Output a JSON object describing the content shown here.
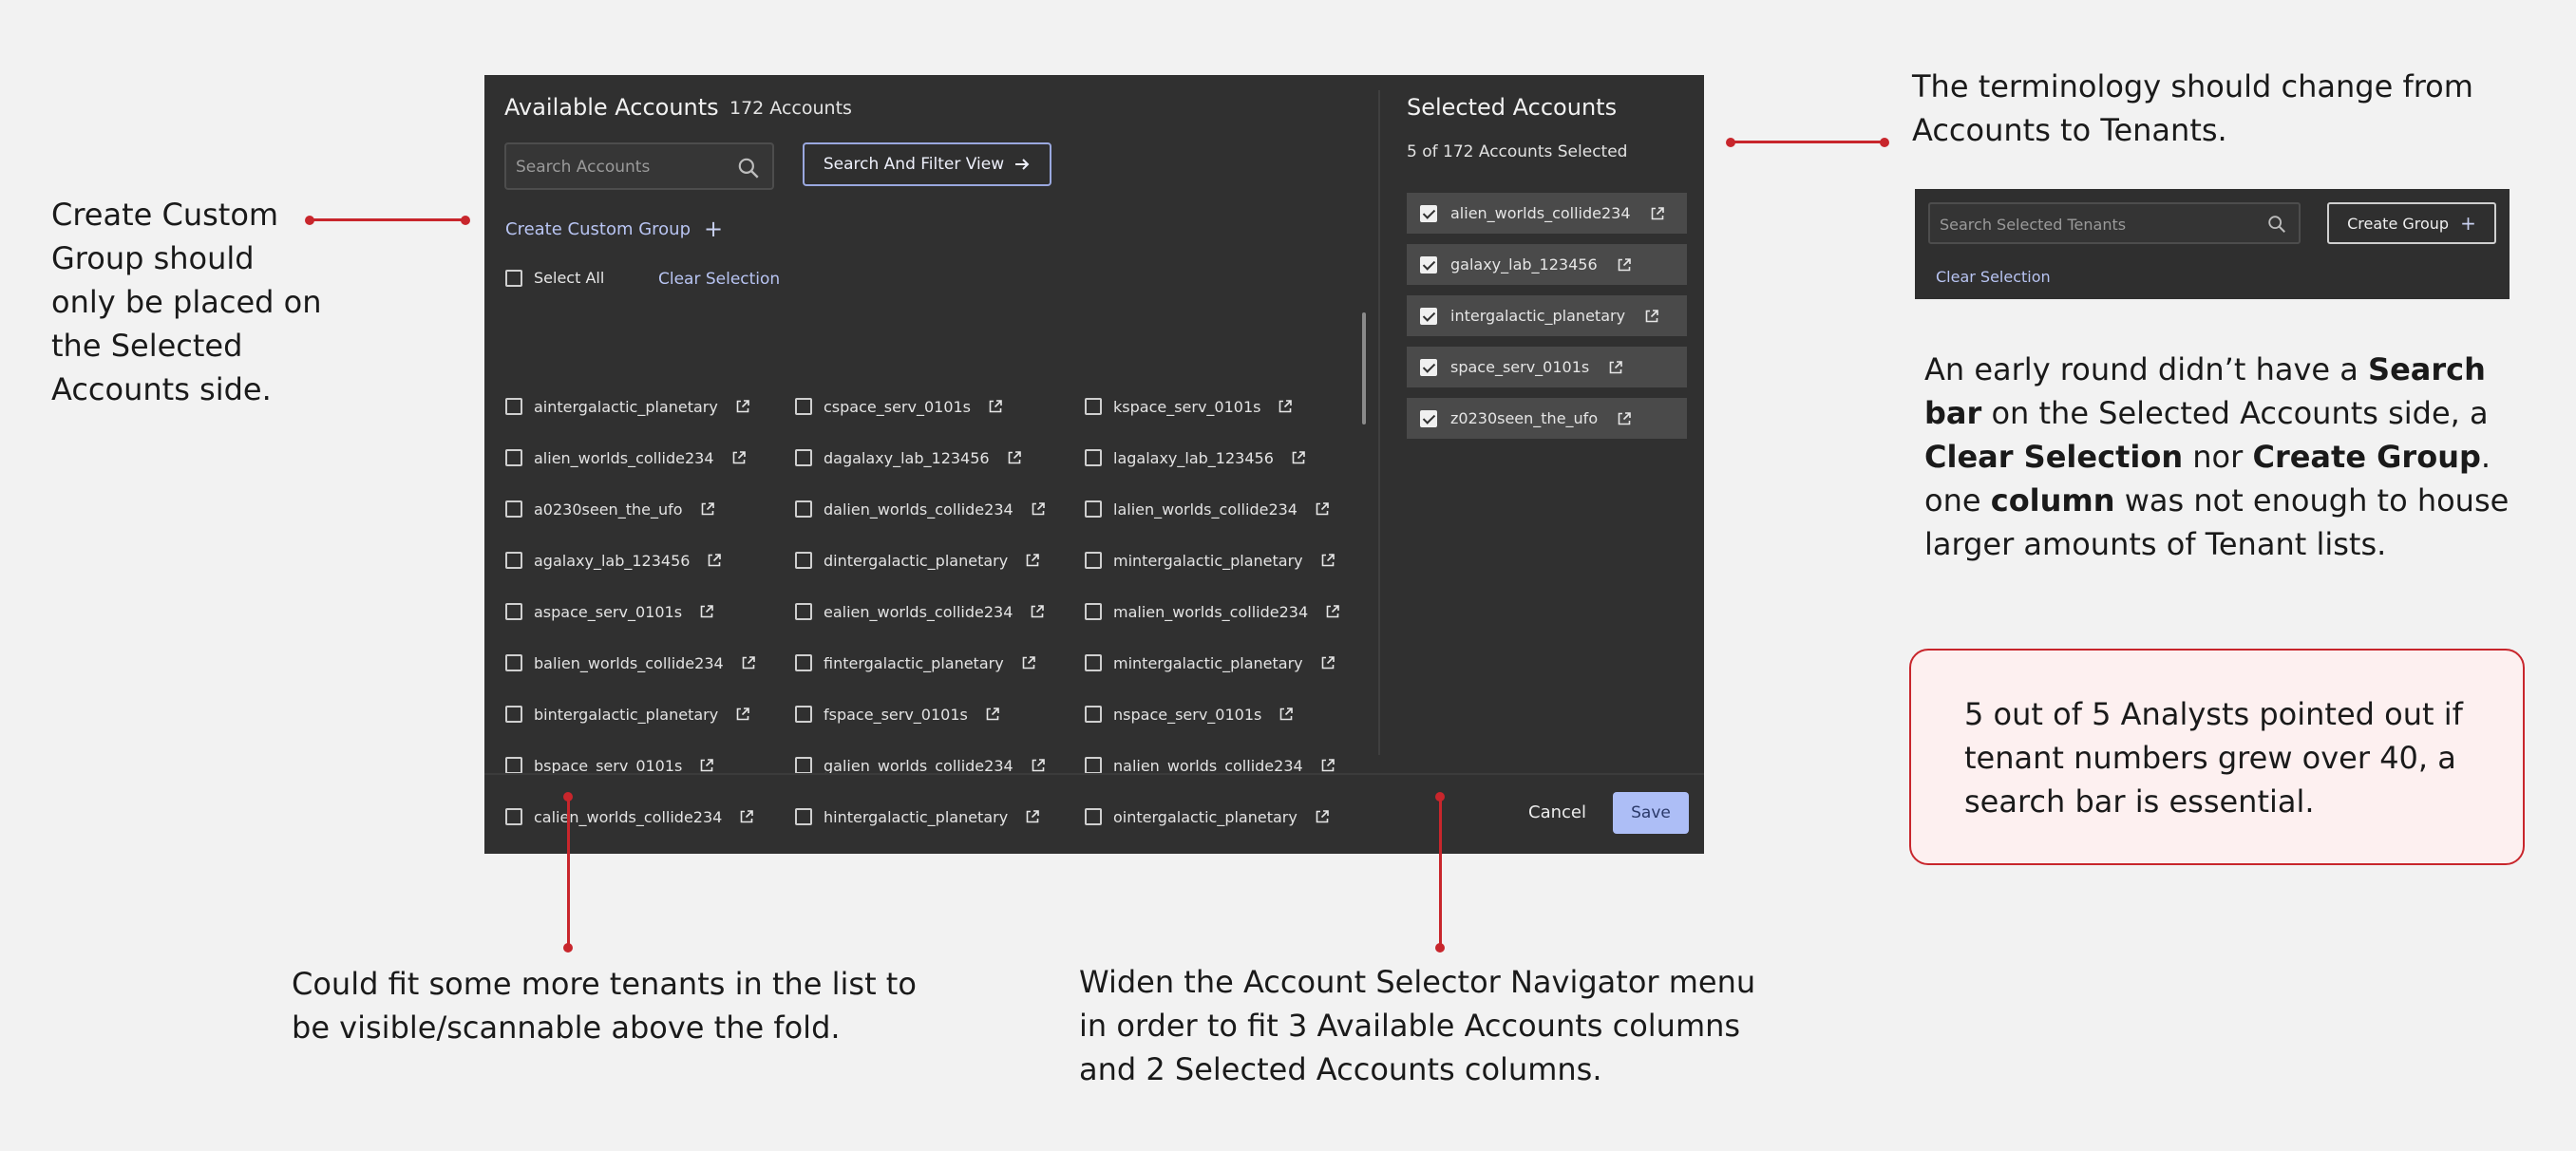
{
  "dialog": {
    "available": {
      "title": "Available Accounts",
      "count": "172 Accounts",
      "search_placeholder": "Search Accounts",
      "filter_button": "Search And Filter View",
      "custom_group": "Create Custom Group",
      "select_all": "Select All",
      "clear_selection": "Clear Selection",
      "columns": [
        [
          "aintergalactic_planetary",
          "alien_worlds_collide234",
          "a0230seen_the_ufo",
          "agalaxy_lab_123456",
          "aspace_serv_0101s",
          "balien_worlds_collide234",
          "bintergalactic_planetary",
          "bspace_serv_0101s",
          "calien_worlds_collide234"
        ],
        [
          "cspace_serv_0101s",
          "dagalaxy_lab_123456",
          "dalien_worlds_collide234",
          "dintergalactic_planetary",
          "ealien_worlds_collide234",
          "fintergalactic_planetary",
          "fspace_serv_0101s",
          "galien_worlds_collide234",
          "hintergalactic_planetary"
        ],
        [
          "kspace_serv_0101s",
          "lagalaxy_lab_123456",
          "lalien_worlds_collide234",
          "mintergalactic_planetary",
          "malien_worlds_collide234",
          "mintergalactic_planetary",
          "nspace_serv_0101s",
          "nalien_worlds_collide234",
          "ointergalactic_planetary"
        ]
      ]
    },
    "selected": {
      "title": "Selected Accounts",
      "count": "5 of 172 Accounts Selected",
      "items": [
        "alien_worlds_collide234",
        "galaxy_lab_123456",
        "intergalactic_planetary",
        "space_serv_0101s",
        "z0230seen_the_ufo"
      ]
    },
    "footer": {
      "cancel": "Cancel",
      "save": "Save"
    }
  },
  "notes": {
    "custom_group": "Create Custom Group should only be placed on the Selected Accounts side.",
    "terminology": "The terminology should change from Accounts to Tenants.",
    "scannable": "Could fit some more tenants in the list to be visible/scannable above the fold.",
    "widen": "Widen the Account Selector Navigator menu in order to fit 3 Available Accounts columns and 2 Selected Accounts columns.",
    "early_round": {
      "p1": "An early round didn’t have a ",
      "b1": "Search bar",
      "p2": " on the Selected Accounts side, a ",
      "b2": "Clear Selection",
      "p3": " nor ",
      "b3": "Create Group",
      "p4": ". one ",
      "b4": "column",
      "p5": " was not enough to house larger amounts of Tenant lists."
    },
    "analysts": "5 out of 5 Analysts pointed out if tenant numbers grew over 40, a search bar is essential."
  },
  "mini_panel": {
    "search_placeholder": "Search Selected Tenants",
    "create_group": "Create Group",
    "clear_selection": "Clear Selection"
  },
  "colors": {
    "accent": "#b8c4f2",
    "save": "#adbef6",
    "annotation_red": "#c8262c",
    "dialog_bg": "#303030"
  }
}
